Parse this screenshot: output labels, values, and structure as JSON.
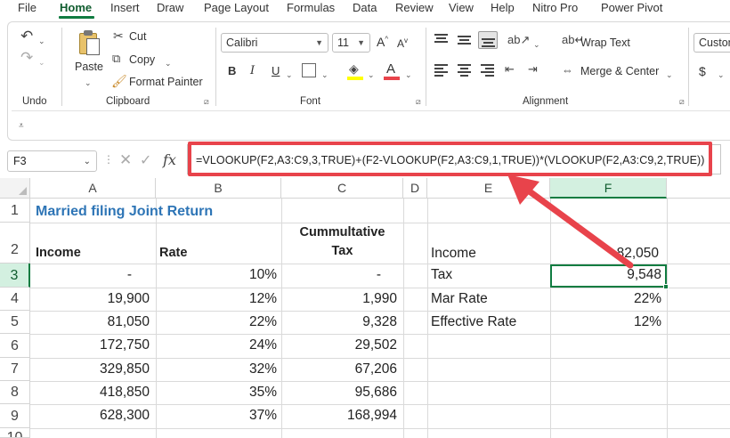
{
  "menu": {
    "tabs": [
      "File",
      "Home",
      "Insert",
      "Draw",
      "Page Layout",
      "Formulas",
      "Data",
      "Review",
      "View",
      "Help",
      "Nitro Pro",
      "Power Pivot"
    ],
    "active": "Home"
  },
  "ribbon": {
    "undo_group": "Undo",
    "clipboard": {
      "paste": "Paste",
      "cut": "Cut",
      "copy": "Copy",
      "format_painter": "Format Painter",
      "group": "Clipboard"
    },
    "font": {
      "name": "Calibri",
      "size": "11",
      "bold": "B",
      "italic": "I",
      "underline": "U",
      "group": "Font",
      "fill_color": "#ffff00",
      "font_color": "#e8434b"
    },
    "alignment": {
      "wrap_text": "Wrap Text",
      "merge_center": "Merge & Center",
      "group": "Alignment"
    },
    "number": {
      "format": "Custom",
      "currency": "$"
    }
  },
  "formula_bar": {
    "name_box": "F3",
    "fx": "fx",
    "formula": "=VLOOKUP(F2,A3:C9,3,TRUE)+(F2-VLOOKUP(F2,A3:C9,1,TRUE))*(VLOOKUP(F2,A3:C9,2,TRUE))"
  },
  "sheet": {
    "columns": [
      "A",
      "B",
      "C",
      "D",
      "E",
      "F"
    ],
    "active_column": "F",
    "rows": [
      "1",
      "2",
      "3",
      "4",
      "5",
      "6",
      "7",
      "8",
      "9",
      "10"
    ],
    "active_row": "3",
    "title": "Married filing Joint Return",
    "headers": {
      "income": "Income",
      "rate": "Rate",
      "cum_tax_line1": "Cummultative",
      "cum_tax_line2": "Tax"
    },
    "table": [
      {
        "income": "-",
        "rate": "10%",
        "tax": "-"
      },
      {
        "income": "19,900",
        "rate": "12%",
        "tax": "1,990"
      },
      {
        "income": "81,050",
        "rate": "22%",
        "tax": "9,328"
      },
      {
        "income": "172,750",
        "rate": "24%",
        "tax": "29,502"
      },
      {
        "income": "329,850",
        "rate": "32%",
        "tax": "67,206"
      },
      {
        "income": "418,850",
        "rate": "35%",
        "tax": "95,686"
      },
      {
        "income": "628,300",
        "rate": "37%",
        "tax": "168,994"
      }
    ],
    "summary": [
      {
        "label": "Income",
        "value": "82,050"
      },
      {
        "label": "Tax",
        "value": "9,548"
      },
      {
        "label": "Mar Rate",
        "value": "22%"
      },
      {
        "label": "Effective Rate",
        "value": "12%"
      }
    ],
    "accent_color": "#107c41",
    "callout_color": "#e8434b"
  }
}
